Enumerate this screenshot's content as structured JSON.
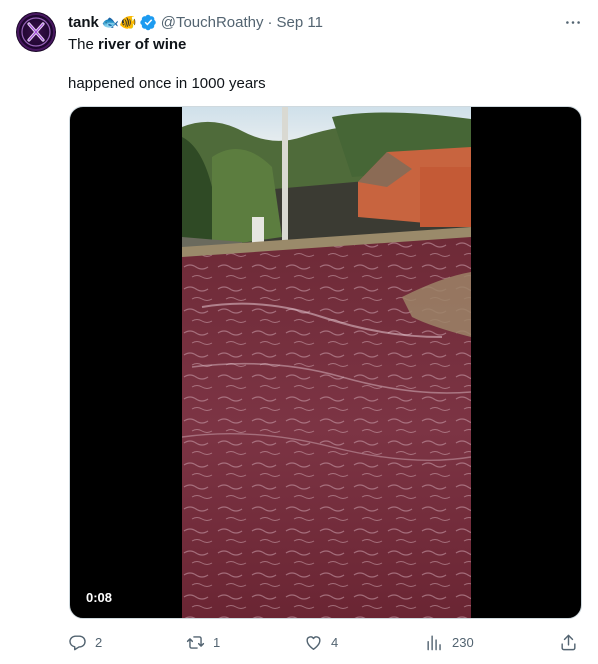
{
  "author": {
    "display_name": "tank",
    "emojis": "🐟🐠",
    "handle": "@TouchRoathy",
    "separator": "·",
    "date": "Sep 11",
    "verified": true
  },
  "tweet": {
    "line1_prefix": "The ",
    "line1_bold": "river of wine",
    "line2": "happened once in 1000 years"
  },
  "media": {
    "type": "video",
    "duration": "0:08"
  },
  "actions": {
    "replies": "2",
    "retweets": "1",
    "likes": "4",
    "views": "230"
  },
  "icons": {
    "more": "more-icon",
    "reply": "reply-icon",
    "retweet": "retweet-icon",
    "like": "like-icon",
    "views": "views-icon",
    "share": "share-icon"
  },
  "colors": {
    "text": "#0f1419",
    "secondary": "#536471",
    "verified": "#1d9bf0",
    "wine": "#7a3040"
  }
}
